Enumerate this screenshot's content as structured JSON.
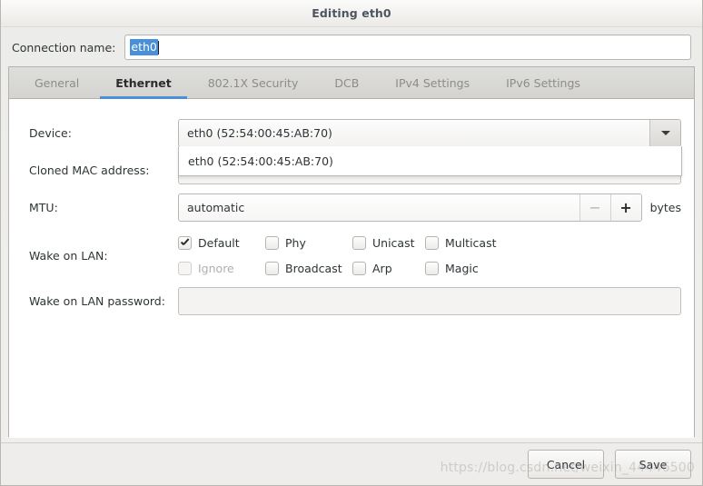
{
  "window": {
    "title": "Editing eth0"
  },
  "connection": {
    "label": "Connection name:",
    "value": "eth0",
    "placeholder": ""
  },
  "tabs": [
    {
      "label": "General",
      "active": false
    },
    {
      "label": "Ethernet",
      "active": true
    },
    {
      "label": "802.1X Security",
      "active": false
    },
    {
      "label": "DCB",
      "active": false
    },
    {
      "label": "IPv4 Settings",
      "active": false
    },
    {
      "label": "IPv6 Settings",
      "active": false
    }
  ],
  "form": {
    "device": {
      "label": "Device:",
      "value": "eth0 (52:54:00:45:AB:70)",
      "expanded": true,
      "options": [
        "eth0 (52:54:00:45:AB:70)"
      ]
    },
    "cloned_mac": {
      "label": "Cloned MAC address:",
      "value": "",
      "placeholder": ""
    },
    "mtu": {
      "label": "MTU:",
      "value": "automatic",
      "minus_label": "−",
      "plus_label": "+",
      "unit": "bytes"
    },
    "wake_on_lan": {
      "label": "Wake on LAN:",
      "row1": [
        {
          "label": "Default",
          "checked": true,
          "disabled": false
        },
        {
          "label": "Phy",
          "checked": false,
          "disabled": false
        },
        {
          "label": "Unicast",
          "checked": false,
          "disabled": false
        },
        {
          "label": "Multicast",
          "checked": false,
          "disabled": false
        }
      ],
      "row2": [
        {
          "label": "Ignore",
          "checked": false,
          "disabled": true
        },
        {
          "label": "Broadcast",
          "checked": false,
          "disabled": false
        },
        {
          "label": "Arp",
          "checked": false,
          "disabled": false
        },
        {
          "label": "Magic",
          "checked": false,
          "disabled": false
        }
      ]
    },
    "wol_password": {
      "label": "Wake on LAN password:",
      "value": "",
      "placeholder": ""
    }
  },
  "actions": {
    "cancel": "Cancel",
    "save": "Save"
  },
  "watermark": {
    "text": "https://blog.csdn.net/weixin_44446500"
  },
  "colors": {
    "accent": "#4a90d9",
    "selection": "#4a90d9",
    "window_bg": "#f2f1f0",
    "page_bg": "#ffffff"
  }
}
